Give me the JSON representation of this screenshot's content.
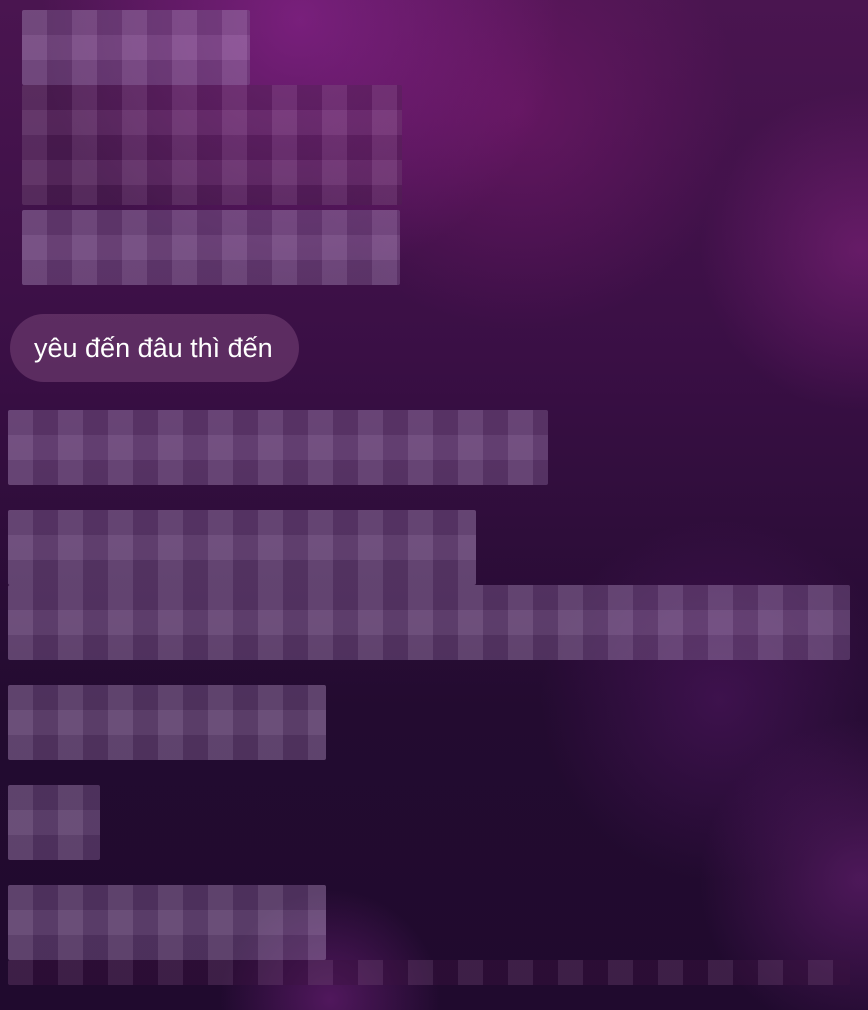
{
  "chat": {
    "messages": [
      {
        "text": "yêu đến đâu thì đến",
        "visible": true
      }
    ],
    "redacted_blocks": 9
  },
  "colors": {
    "bubble": "#7a4a7c",
    "background_top": "#4a1550",
    "background_bottom": "#200a2e"
  }
}
